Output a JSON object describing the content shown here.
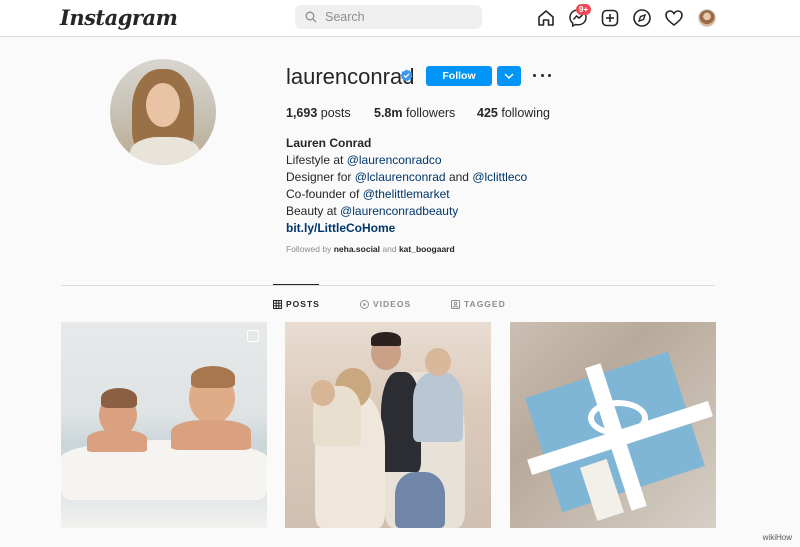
{
  "topbar": {
    "logo": "Instagram",
    "search_placeholder": "Search",
    "messages_badge": "9+"
  },
  "profile": {
    "username": "laurenconrad",
    "follow_label": "Follow",
    "stats": {
      "posts_count": "1,693",
      "posts_label": "posts",
      "followers_count": "5.8m",
      "followers_label": "followers",
      "following_count": "425",
      "following_label": "following"
    },
    "bio": {
      "name": "Lauren Conrad",
      "line1_text": "Lifestyle at ",
      "line1_link": "@laurenconradco",
      "line2_text": "Designer for ",
      "line2_link_a": "@lclaurenconrad",
      "line2_and": " and ",
      "line2_link_b": "@lclittleco",
      "line3_text": "Co-founder of ",
      "line3_link": "@thelittlemarket",
      "line4_text": "Beauty at ",
      "line4_link": "@laurenconradbeauty",
      "url": "bit.ly/LittleCoHome"
    },
    "followed_by": {
      "prefix": "Followed by ",
      "user_a": "neha.social",
      "and": " and ",
      "user_b": "kat_boogaard"
    }
  },
  "tabs": [
    {
      "label": "POSTS",
      "active": true,
      "icon": "grid-icon"
    },
    {
      "label": "VIDEOS",
      "active": false,
      "icon": "play-icon"
    },
    {
      "label": "TAGGED",
      "active": false,
      "icon": "tag-icon"
    }
  ],
  "watermark": "wikiHow",
  "colors": {
    "accent": "#0095f6",
    "link": "#00376b",
    "badge": "#ed4956"
  }
}
